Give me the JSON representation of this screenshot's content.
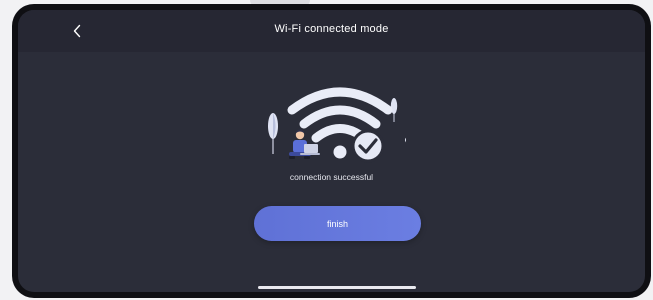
{
  "header": {
    "title": "Wi-Fi connected mode",
    "back_icon": "chevron-left-icon"
  },
  "main": {
    "illustration": "wifi-connected-illustration",
    "status_text": "connection successful",
    "finish_label": "finish"
  },
  "colors": {
    "screen_background": "#2b2d39",
    "header_background": "#262733",
    "button_accent": "#6475dc",
    "success_check": "#ffffff"
  }
}
